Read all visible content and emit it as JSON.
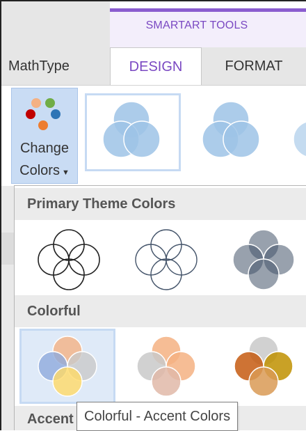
{
  "contextual_tab": {
    "label": "SMARTART TOOLS",
    "accent": "#7a48c2"
  },
  "tabs": [
    {
      "label": "MathType",
      "selected": false
    },
    {
      "label": "DESIGN",
      "selected": true
    },
    {
      "label": "FORMAT",
      "selected": false
    }
  ],
  "change_colors": {
    "line1": "Change",
    "line2": "Colors",
    "icon": "palette-dots-icon",
    "dropdown_icon": "chevron-down-icon"
  },
  "sections": [
    {
      "label": "Primary Theme Colors"
    },
    {
      "label": "Colorful"
    },
    {
      "label": "Accent"
    }
  ],
  "tooltip": {
    "text": "Colorful - Accent Colors"
  },
  "colors": {
    "gallery_blue": "#9dc3e6",
    "gallery_blue_stroke": "#ffffff",
    "selection_border": "#c6daf3",
    "orange": "#f4b183",
    "gray": "#c9c9c9",
    "blue": "#8faadc",
    "yellow": "#ffd966",
    "dark_orange": "#c55a11",
    "gold": "#bf9000",
    "slate": "#8497b0"
  }
}
